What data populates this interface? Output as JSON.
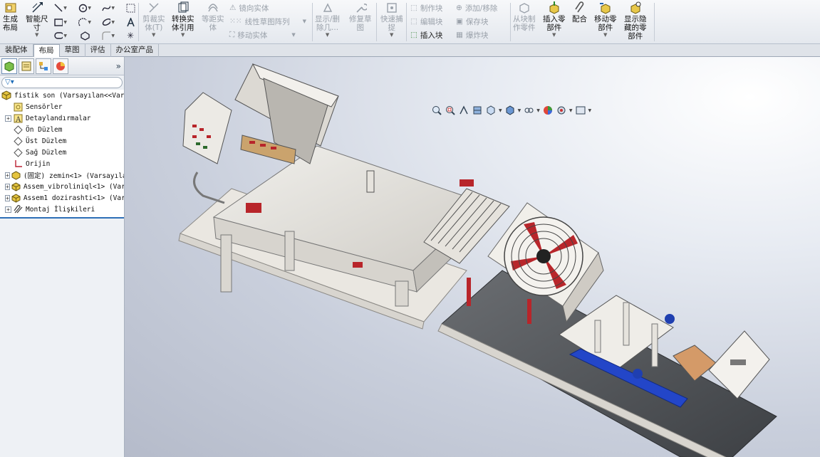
{
  "ribbon": {
    "make_layout": "生成\n布局",
    "smart_dim": "智能尺\n寸",
    "trim": "剪裁实\n体(T)",
    "convert": "转换实\n体引用",
    "offset": "等距实\n体",
    "mirror": "镜向实体",
    "linear_pattern": "线性草图阵列",
    "move": "移动实体",
    "show_delete": "显示/删\n除几...",
    "repair": "修复草\n图",
    "quick_snap": "快速捕\n捉",
    "make_block": "制作块",
    "edit_block": "编辑块",
    "insert_block": "插入块",
    "add_remove": "添加/移除",
    "save_block": "保存块",
    "explode_block": "爆炸块",
    "from_block": "从块制\n作零件",
    "insert_part": "插入零\n部件",
    "mate": "配合",
    "move_part": "移动零\n部件",
    "show_hidden": "显示隐\n藏的零\n部件"
  },
  "tabs": [
    "装配体",
    "布局",
    "草图",
    "评估",
    "办公室产品"
  ],
  "active_tab": "布局",
  "panel": {
    "collapse": "»",
    "tree": [
      {
        "label": "fistik son  (Varsayılan<<Vars",
        "icon": "assembly-icon",
        "exp": ""
      },
      {
        "label": "Sensörler",
        "icon": "sensor-icon",
        "exp": "none"
      },
      {
        "label": "Detaylandırmalar",
        "icon": "annotation-icon",
        "exp": "+"
      },
      {
        "label": "Ön Düzlem",
        "icon": "plane-icon",
        "exp": "none"
      },
      {
        "label": "Üst Düzlem",
        "icon": "plane-icon",
        "exp": "none"
      },
      {
        "label": "Sağ Düzlem",
        "icon": "plane-icon",
        "exp": "none"
      },
      {
        "label": "Orijin",
        "icon": "origin-icon",
        "exp": "none"
      },
      {
        "label": "(固定) zemin<1> (Varsayıla",
        "icon": "part-icon",
        "exp": "+"
      },
      {
        "label": "Assem_vibroliniql<1> (Var",
        "icon": "subassembly-icon",
        "exp": "+"
      },
      {
        "label": "Assem1 dozirashti<1> (Var",
        "icon": "subassembly-icon",
        "exp": "+"
      },
      {
        "label": "Montaj İlişkileri",
        "icon": "mates-icon",
        "exp": "+"
      }
    ]
  },
  "colors": {
    "accent": "#2d6fb7",
    "frame": "#e9e7e2",
    "guard_red": "#c0282b"
  }
}
